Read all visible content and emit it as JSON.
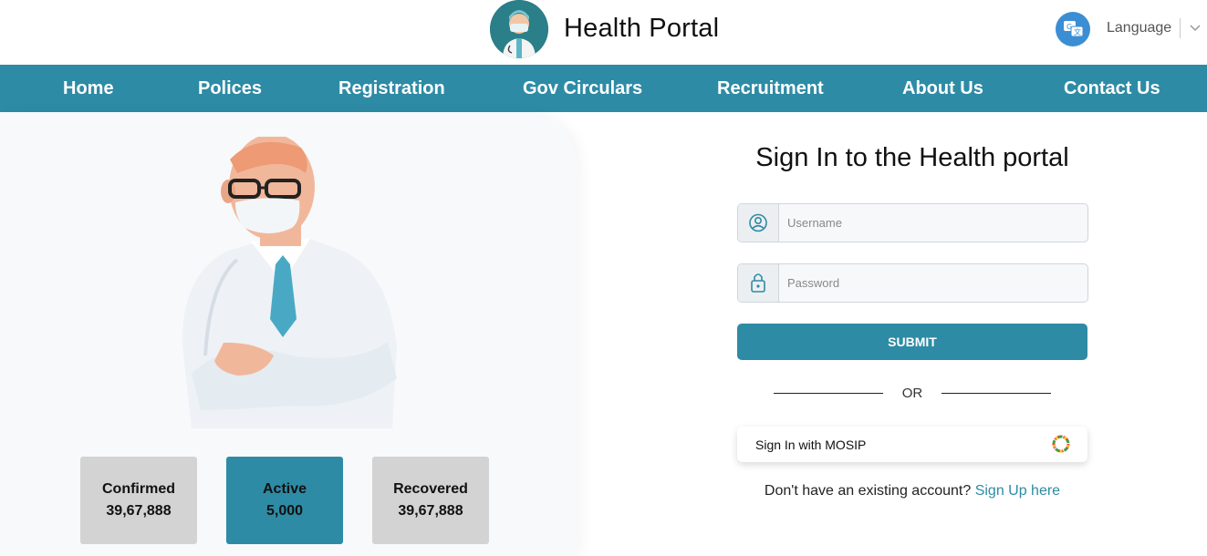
{
  "header": {
    "brand": "Health Portal",
    "language_label": "Language",
    "logo_icon": "doctor-avatar-icon",
    "language_icon": "translate-icon"
  },
  "nav": {
    "items": [
      "Home",
      "Polices",
      "Registration",
      "Gov Circulars",
      "Recruitment",
      "About Us",
      "Contact Us"
    ]
  },
  "stats": [
    {
      "label": "Confirmed",
      "value": "39,67,888"
    },
    {
      "label": "Active",
      "value": "5,000"
    },
    {
      "label": "Recovered",
      "value": "39,67,888"
    }
  ],
  "form": {
    "title": "Sign In to the Health portal",
    "username_placeholder": "Username",
    "password_placeholder": "Password",
    "submit_label": "SUBMIT",
    "or_text": "OR",
    "mosip_label": "Sign In with MOSIP",
    "signup_prompt": "Don't have an existing account?",
    "signup_link": "Sign Up here"
  },
  "colors": {
    "primary": "#2e8ba5",
    "stat_grey": "#d3d3d3",
    "link": "#2e8ba5"
  }
}
